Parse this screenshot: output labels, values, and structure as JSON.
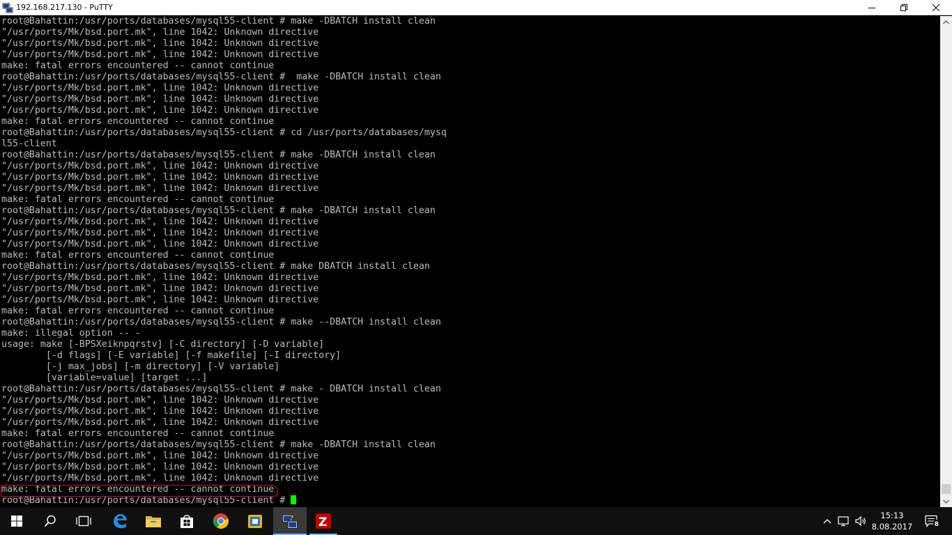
{
  "window": {
    "title": "192.168.217.130 - PuTTY"
  },
  "terminal": {
    "lines": [
      "root@Bahattin:/usr/ports/databases/mysql55-client # make -DBATCH install clean",
      "\"/usr/ports/Mk/bsd.port.mk\", line 1042: Unknown directive",
      "\"/usr/ports/Mk/bsd.port.mk\", line 1042: Unknown directive",
      "\"/usr/ports/Mk/bsd.port.mk\", line 1042: Unknown directive",
      "make: fatal errors encountered -- cannot continue",
      "root@Bahattin:/usr/ports/databases/mysql55-client #  make -DBATCH install clean",
      "\"/usr/ports/Mk/bsd.port.mk\", line 1042: Unknown directive",
      "\"/usr/ports/Mk/bsd.port.mk\", line 1042: Unknown directive",
      "\"/usr/ports/Mk/bsd.port.mk\", line 1042: Unknown directive",
      "make: fatal errors encountered -- cannot continue",
      "root@Bahattin:/usr/ports/databases/mysql55-client # cd /usr/ports/databases/mysq",
      "l55-client",
      "root@Bahattin:/usr/ports/databases/mysql55-client # make -DBATCH install clean",
      "\"/usr/ports/Mk/bsd.port.mk\", line 1042: Unknown directive",
      "\"/usr/ports/Mk/bsd.port.mk\", line 1042: Unknown directive",
      "\"/usr/ports/Mk/bsd.port.mk\", line 1042: Unknown directive",
      "make: fatal errors encountered -- cannot continue",
      "root@Bahattin:/usr/ports/databases/mysql55-client # make -DBATCH install clean",
      "\"/usr/ports/Mk/bsd.port.mk\", line 1042: Unknown directive",
      "\"/usr/ports/Mk/bsd.port.mk\", line 1042: Unknown directive",
      "\"/usr/ports/Mk/bsd.port.mk\", line 1042: Unknown directive",
      "make: fatal errors encountered -- cannot continue",
      "root@Bahattin:/usr/ports/databases/mysql55-client # make DBATCH install clean",
      "\"/usr/ports/Mk/bsd.port.mk\", line 1042: Unknown directive",
      "\"/usr/ports/Mk/bsd.port.mk\", line 1042: Unknown directive",
      "\"/usr/ports/Mk/bsd.port.mk\", line 1042: Unknown directive",
      "make: fatal errors encountered -- cannot continue",
      "root@Bahattin:/usr/ports/databases/mysql55-client # make --DBATCH install clean",
      "make: illegal option -- -",
      "usage: make [-BPSXeiknpqrstv] [-C directory] [-D variable]",
      "        [-d flags] [-E variable] [-f makefile] [-I directory]",
      "        [-j max_jobs] [-m directory] [-V variable]",
      "        [variable=value] [target ...]",
      "root@Bahattin:/usr/ports/databases/mysql55-client # make - DBATCH install clean",
      "\"/usr/ports/Mk/bsd.port.mk\", line 1042: Unknown directive",
      "\"/usr/ports/Mk/bsd.port.mk\", line 1042: Unknown directive",
      "\"/usr/ports/Mk/bsd.port.mk\", line 1042: Unknown directive",
      "make: fatal errors encountered -- cannot continue",
      "root@Bahattin:/usr/ports/databases/mysql55-client # make -DBATCH install clean",
      "\"/usr/ports/Mk/bsd.port.mk\", line 1042: Unknown directive",
      "\"/usr/ports/Mk/bsd.port.mk\", line 1042: Unknown directive",
      "\"/usr/ports/Mk/bsd.port.mk\", line 1042: Unknown directive",
      "make: fatal errors encountered -- cannot continue"
    ],
    "prompt": "root@Bahattin:/usr/ports/databases/mysql55-client # ",
    "text_color": "#bbbbbb",
    "background": "#000000",
    "cursor_color": "#00ff00",
    "annotation_color": "#d0112b"
  },
  "taskbar": {
    "items": [
      {
        "icon": "windows-start-icon"
      },
      {
        "icon": "search-icon"
      },
      {
        "icon": "task-view-icon"
      },
      {
        "icon": "edge-icon"
      },
      {
        "icon": "file-explorer-icon"
      },
      {
        "icon": "store-icon"
      },
      {
        "icon": "chrome-icon"
      },
      {
        "icon": "app-icon"
      },
      {
        "icon": "putty-icon",
        "active": true
      },
      {
        "icon": "filezilla-icon",
        "open": true
      }
    ],
    "tray": {
      "icons": [
        "chevron-up-icon",
        "network-icon",
        "volume-icon"
      ],
      "time": "15:13",
      "date": "8.08.2017",
      "notification_count": "8"
    }
  }
}
